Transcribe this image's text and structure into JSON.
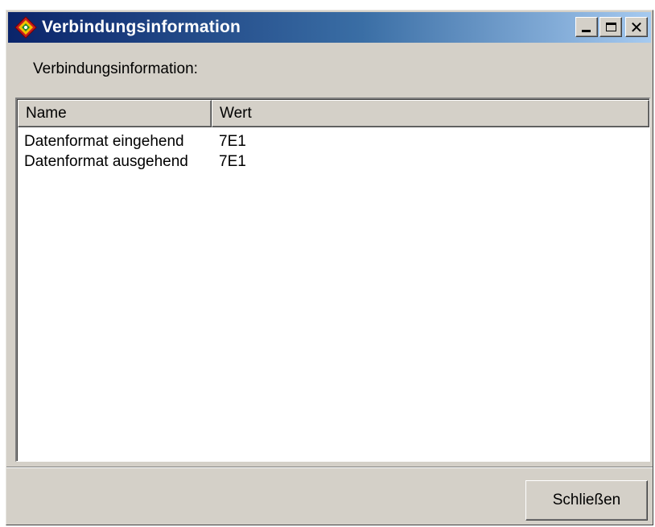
{
  "window": {
    "title": "Verbindungsinformation",
    "icon": "app-icon",
    "controls": {
      "minimize_icon": "minimize-icon",
      "maximize_icon": "maximize-icon",
      "close_glyph": "✕"
    }
  },
  "dialog": {
    "label": "Verbindungsinformation:"
  },
  "listview": {
    "columns": [
      "Name",
      "Wert"
    ],
    "rows": [
      {
        "name": "Datenformat eingehend",
        "value": "7E1"
      },
      {
        "name": "Datenformat ausgehend",
        "value": "7E1"
      }
    ]
  },
  "buttons": {
    "close_label": "Schließen"
  },
  "colors": {
    "titlebar_start": "#0a246a",
    "titlebar_end": "#a6caf0",
    "face": "#d4d0c8"
  }
}
